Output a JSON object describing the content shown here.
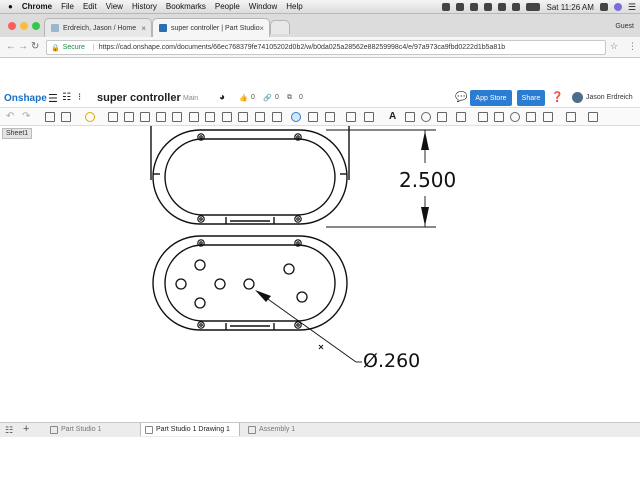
{
  "mac_menu": {
    "app": "Chrome",
    "items": [
      "File",
      "Edit",
      "View",
      "History",
      "Bookmarks",
      "People",
      "Window",
      "Help"
    ],
    "clock": "Sat 11:26 AM"
  },
  "browser": {
    "tabs": [
      {
        "title": "Erdreich, Jason / Home",
        "active": false
      },
      {
        "title": "super controller | Part Studio",
        "active": true
      }
    ],
    "profile": "Guest",
    "secure_label": "Secure",
    "url": "https://cad.onshape.com/documents/66ec768379fe74105202d0b2/w/b0da025a28562e88259998c4/e/97a973ca9fbd0222d1b5a81b"
  },
  "onshape": {
    "logo": "Onshape",
    "doc_title": "super controller",
    "branch": "Main",
    "likes": "0",
    "links": "0",
    "copies": "0",
    "app_store_label": "App Store",
    "share_label": "Share",
    "user": "Jason Erdreich",
    "sheet": "Sheet1"
  },
  "drawing": {
    "dim_vertical": "2.500",
    "dim_hole": "Ø.260"
  },
  "bottom_tabs": [
    {
      "label": "Part Studio 1",
      "active": false
    },
    {
      "label": "Part Studio 1 Drawing 1",
      "active": true
    },
    {
      "label": "Assembly 1",
      "active": false
    }
  ],
  "colors": {
    "accent": "#2a7dd1",
    "drawing_line": "#111111"
  }
}
